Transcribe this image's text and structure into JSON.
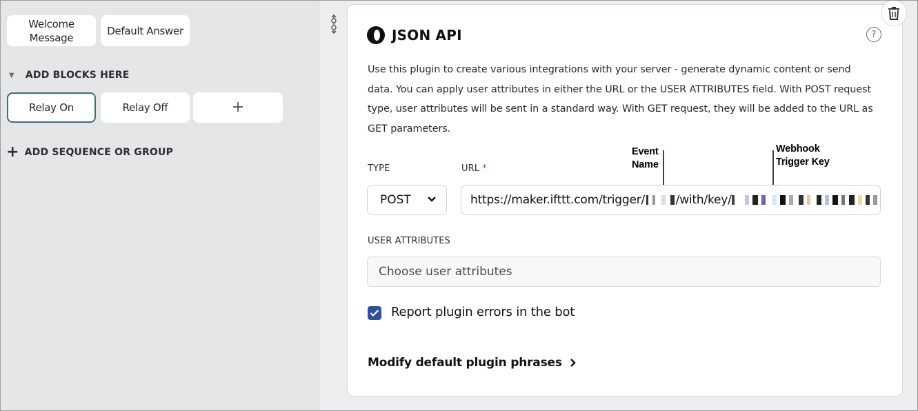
{
  "blocks": {
    "top": [
      {
        "label": "Welcome Message"
      },
      {
        "label": "Default Answer"
      }
    ],
    "add_blocks_header": "ADD BLOCKS HERE",
    "row": [
      {
        "label": "Relay On",
        "selected": true
      },
      {
        "label": "Relay Off"
      },
      {
        "label": "+"
      }
    ],
    "add_sequence": "ADD SEQUENCE OR GROUP"
  },
  "plugin": {
    "title": "JSON API",
    "icon": "json-api-plugin-logo",
    "help_icon": "?",
    "description": "Use this plugin to create various integrations with your server - generate dynamic content or send data. You can apply user attributes in either the URL or the USER ATTRIBUTES field. With POST request type, user attributes will be sent in a standard way. With GET request, they will be added to the URL as GET parameters.",
    "type_label": "TYPE",
    "type_value": "POST",
    "url_label": "URL",
    "url_required": "*",
    "url_prefix": "https://maker.ifttt.com/trigger/",
    "url_middle": "/with/key/",
    "user_attributes_label": "USER ATTRIBUTES",
    "user_attributes_placeholder": "Choose user attributes",
    "report_errors_label": "Report plugin errors in the bot",
    "report_errors_checked": true,
    "modify_phrases_label": "Modify default plugin phrases"
  },
  "annotations": {
    "event_name": "Event\nName",
    "webhook_key": "Webhook\nTrigger Key"
  },
  "colors": {
    "accent_border": "#3e6f73",
    "checkbox": "#2f4f9e",
    "required": "#d23b3b"
  }
}
